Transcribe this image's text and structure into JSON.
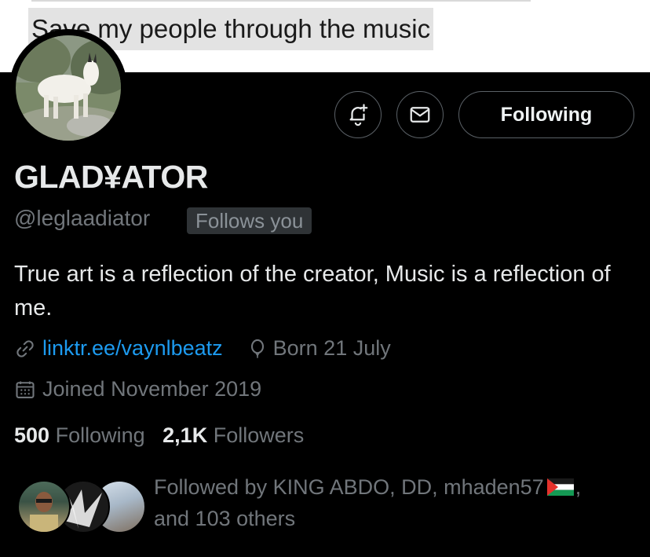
{
  "banner": {
    "text": "Save my people through the music"
  },
  "actions": {
    "notify_icon": "bell-plus-icon",
    "message_icon": "envelope-icon",
    "follow_label": "Following"
  },
  "profile": {
    "display_name": "GLAD¥ATOR",
    "handle": "@leglaadiator",
    "follows_you_badge": "Follows you",
    "bio": "True art is a reflection of the creator, Music is a reflection of me.",
    "website": "linktr.ee/vaynlbeatz",
    "birthday": "Born 21 July",
    "joined": "Joined November 2019"
  },
  "stats": {
    "following_count": "500",
    "following_label": "Following",
    "followers_count": "2,1K",
    "followers_label": "Followers"
  },
  "followed_by": {
    "prefix": "Followed by KING ABDO, DD, mhaden57",
    "flag_icon": "palestine-flag-icon",
    "suffix": ",",
    "others": "and 103 others"
  },
  "colors": {
    "background": "#000000",
    "text_primary": "#e7e9ea",
    "text_secondary": "#71767b",
    "link": "#1d9bf0",
    "button_border": "#5b6167"
  }
}
